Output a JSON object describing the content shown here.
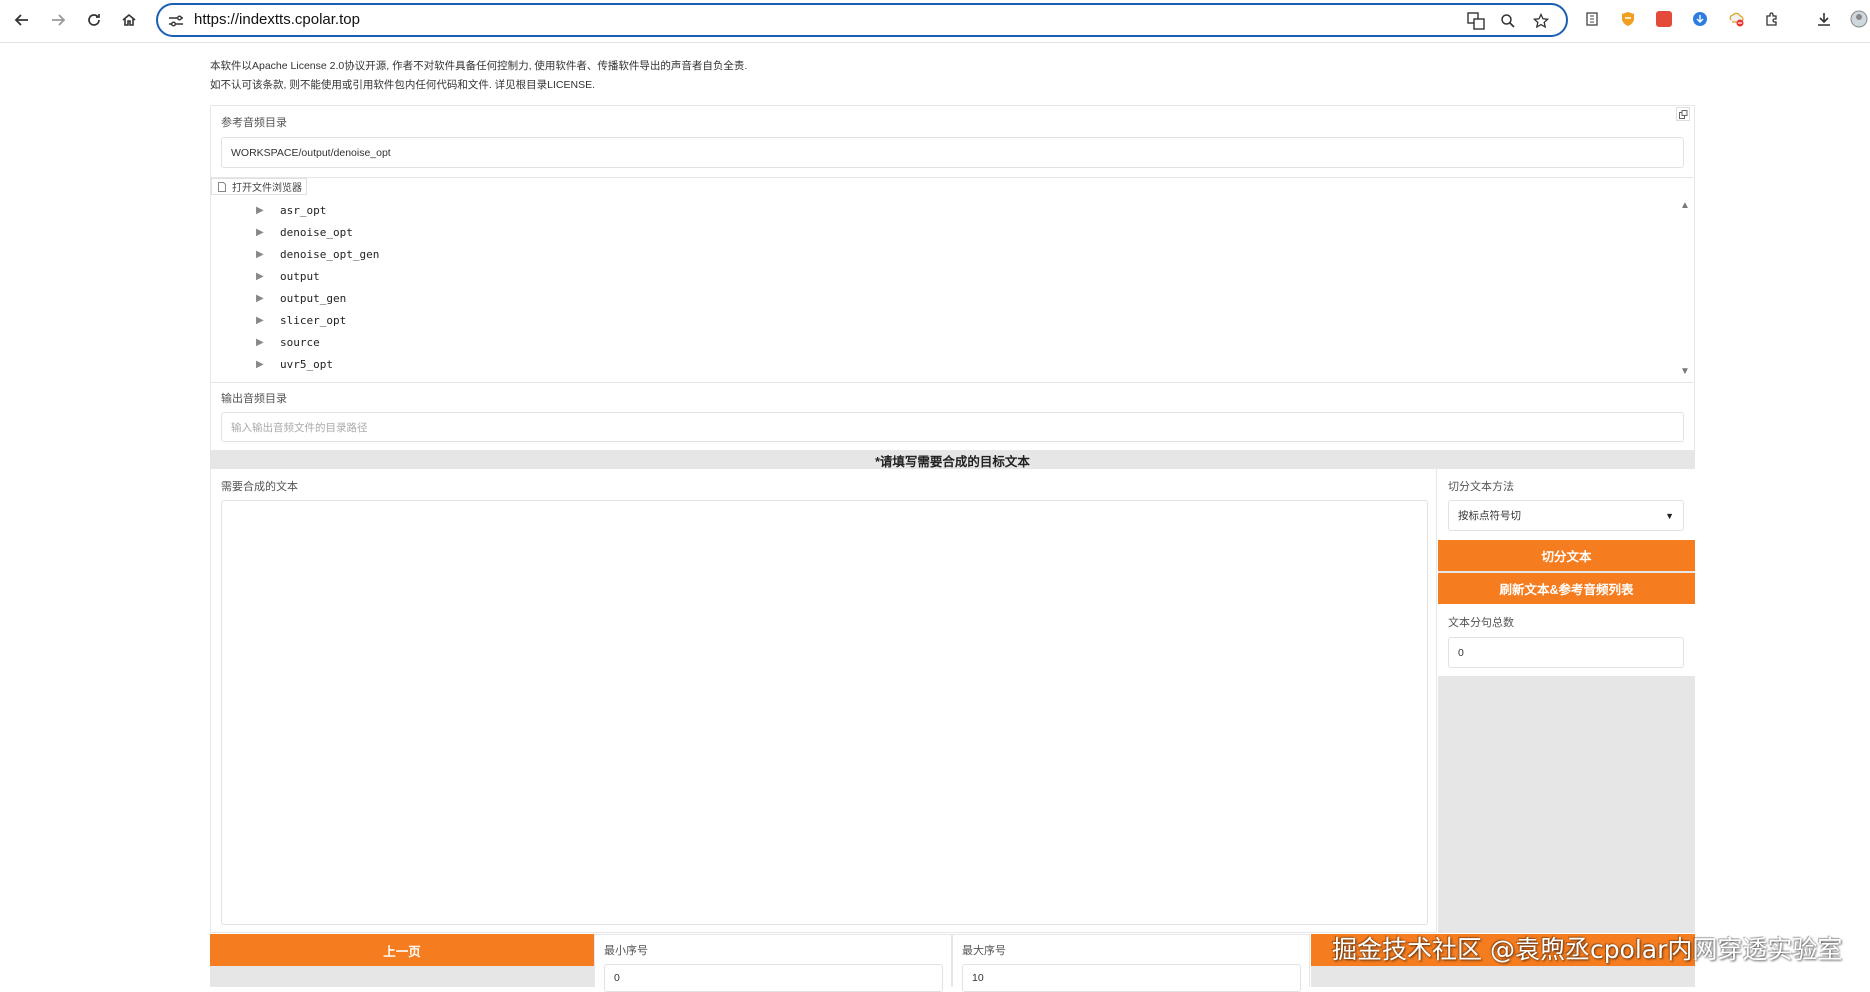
{
  "browser": {
    "url": "https://indextts.cpolar.top",
    "icons": [
      "back-icon",
      "forward-icon",
      "reload-icon",
      "home-icon",
      "site-settings-icon",
      "translate-icon",
      "zoom-icon",
      "star-icon",
      "reading-list-icon",
      "shield-extension-icon",
      "red-extension-icon",
      "blue-extension-icon",
      "cloud-extension-icon",
      "extensions-puzzle-icon",
      "download-icon",
      "profile-icon"
    ]
  },
  "notice": {
    "line1": "本软件以Apache License 2.0协议开源, 作者不对软件具备任何控制力, 使用软件者、传播软件导出的声音者自负全责.",
    "line2": "如不认可该条款, 则不能使用或引用软件包内任何代码和文件. 详见根目录LICENSE."
  },
  "ref_audio": {
    "label": "参考音频目录",
    "value": "WORKSPACE/output/denoise_opt",
    "browser_button": "打开文件浏览器",
    "folders": [
      "asr_opt",
      "denoise_opt",
      "denoise_opt_gen",
      "output",
      "output_gen",
      "slicer_opt",
      "source",
      "uvr5_opt"
    ]
  },
  "output_audio": {
    "label": "输出音频目录",
    "placeholder": "输入输出音频文件的目录路径"
  },
  "section_header": "*请填写需要合成的目标文本",
  "synth_text": {
    "label": "需要合成的文本",
    "value": ""
  },
  "split": {
    "method_label": "切分文本方法",
    "method_value": "按标点符号切",
    "split_button": "切分文本",
    "refresh_button": "刷新文本&参考音频列表",
    "count_label": "文本分句总数",
    "count_value": "0"
  },
  "pager": {
    "prev_button": "上一页",
    "min_label": "最小序号",
    "min_value": "0",
    "max_label": "最大序号",
    "max_value": "10"
  },
  "watermark": "掘金技术社区 @袁煦丞cpolar内网穿透实验室",
  "colors": {
    "accent": "#f57c1f",
    "url_focus": "#1a5fb4"
  }
}
